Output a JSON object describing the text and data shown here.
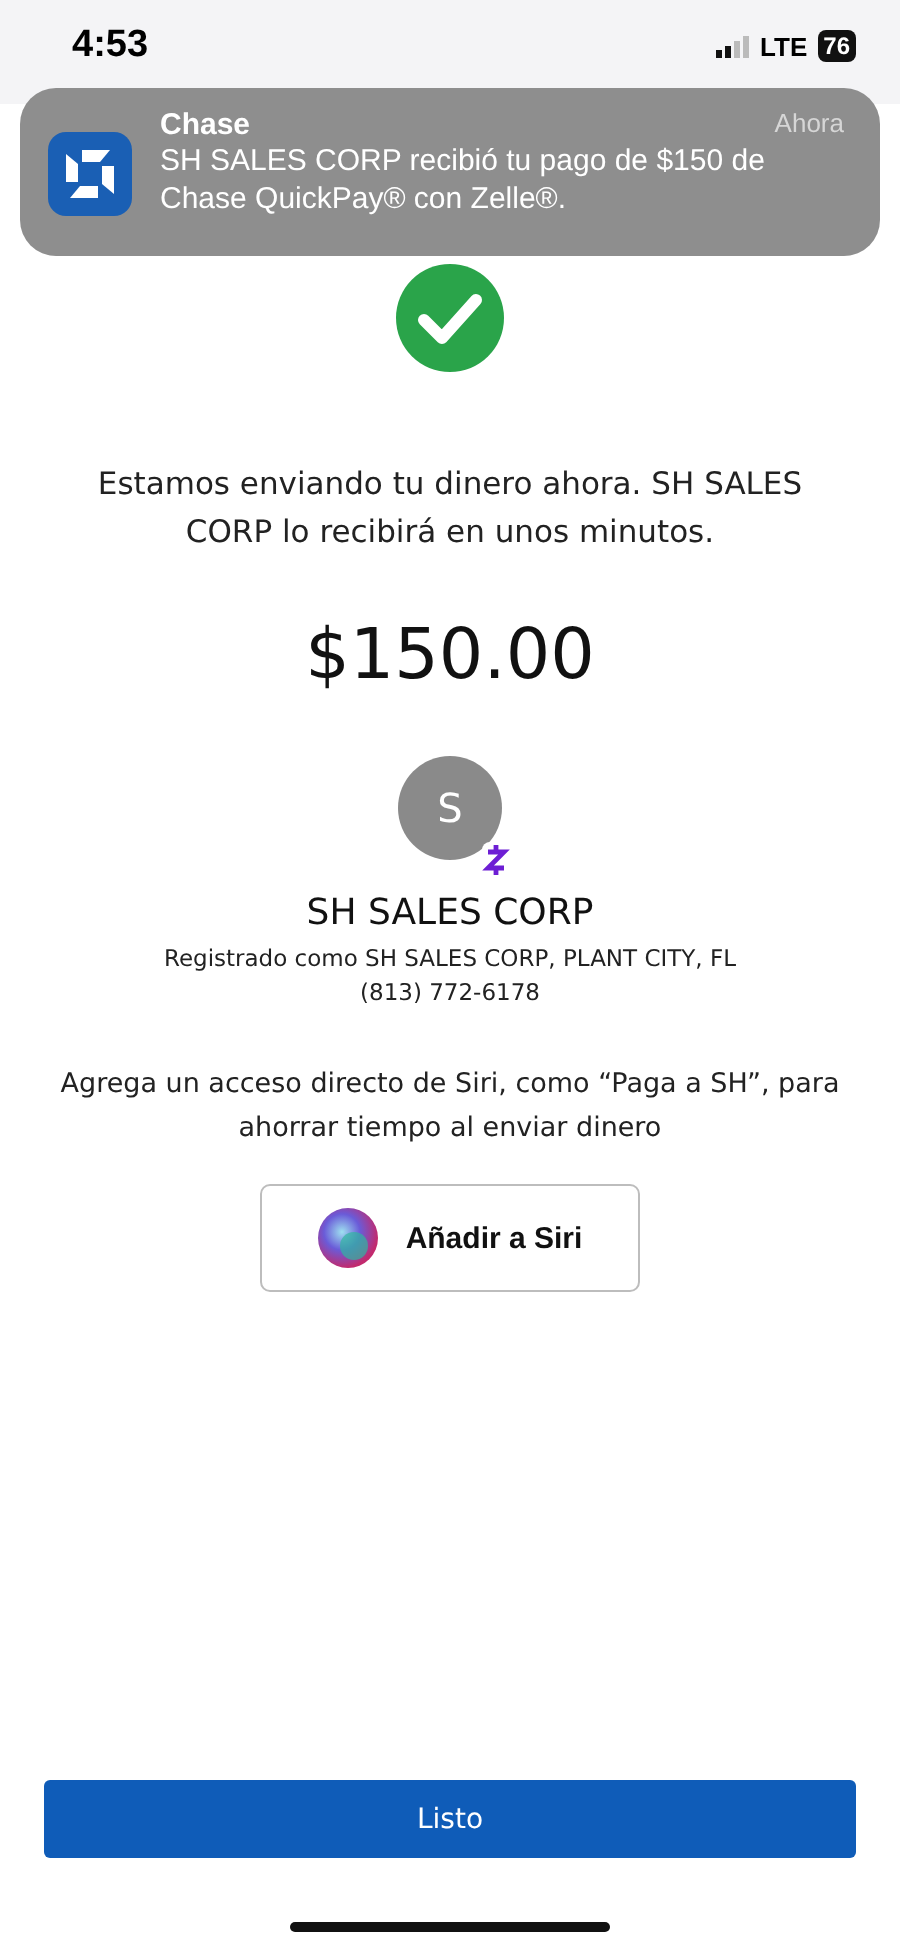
{
  "status_bar": {
    "time": "4:53",
    "network": "LTE",
    "battery": "76"
  },
  "notification": {
    "app": "Chase",
    "time": "Ahora",
    "message": "SH SALES CORP  recibió tu pago de $150 de Chase QuickPay® con Zelle®."
  },
  "confirmation": {
    "message": "Estamos enviando tu dinero ahora. SH SALES CORP  lo recibirá en unos minutos.",
    "amount": "$150.00"
  },
  "recipient": {
    "initial": "S",
    "name": "SH SALES CORP",
    "registered": "Registrado como SH SALES CORP, PLANT CITY, FL",
    "phone": "(813) 772-6178"
  },
  "siri": {
    "prompt": "Agrega un acceso directo de Siri, como “Paga a SH”, para ahorrar tiempo al enviar dinero",
    "button": "Añadir a Siri"
  },
  "done_button": "Listo"
}
